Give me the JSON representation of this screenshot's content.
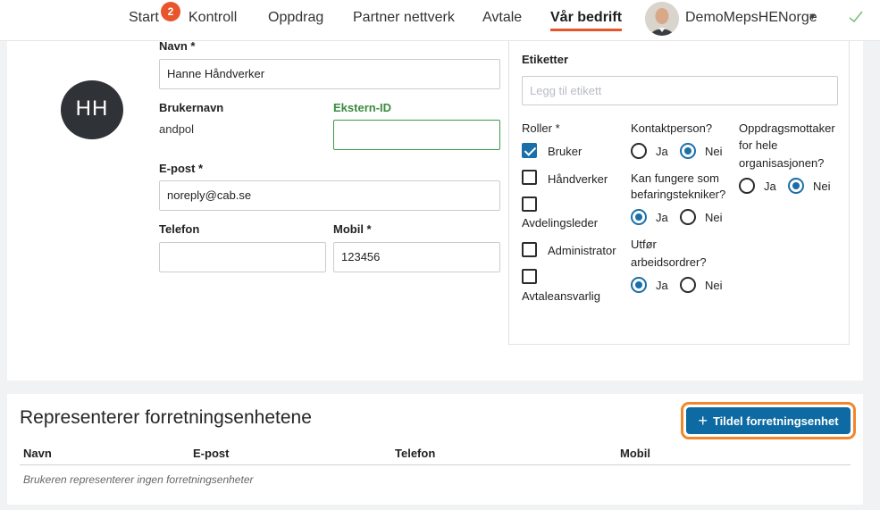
{
  "nav": {
    "items": [
      "Start",
      "Kontroll",
      "Oppdrag",
      "Partner nettverk",
      "Avtale",
      "Vår bedrift"
    ],
    "badge_count": "2",
    "account_name": "DemoMepsHENorge"
  },
  "user": {
    "initials": "HH",
    "name_label": "Navn *",
    "name_value": "Hanne Håndverker",
    "username_label": "Brukernavn",
    "username_value": "andpol",
    "external_id_label": "Ekstern-ID",
    "external_id_value": "",
    "email_label": "E-post *",
    "email_value": "noreply@cab.se",
    "phone_label": "Telefon",
    "phone_value": "",
    "mobile_label": "Mobil *",
    "mobile_value": "123456"
  },
  "tags": {
    "label": "Etiketter",
    "placeholder": "Legg til etikett"
  },
  "roles": {
    "label": "Roller *",
    "items": [
      {
        "label": "Bruker",
        "checked": true
      },
      {
        "label": "Håndverker",
        "checked": false
      },
      {
        "label": "Avdelingsleder",
        "checked": false
      },
      {
        "label": "Administrator",
        "checked": false
      },
      {
        "label": "Avtaleansvarlig",
        "checked": false
      }
    ]
  },
  "contact_person": {
    "label": "Kontaktperson?",
    "yes": "Ja",
    "no": "Nei",
    "selected": "Nei"
  },
  "inspection_tech": {
    "label_line1": "Kan fungere som",
    "label_line2": "befaringstekniker?",
    "yes": "Ja",
    "no": "Nei",
    "selected": "Ja"
  },
  "work_orders": {
    "label_line1": "Utfør",
    "label_line2": "arbeidsordrer?",
    "yes": "Ja",
    "no": "Nei",
    "selected": "Ja"
  },
  "org_receiver": {
    "label_line1": "Oppdragsmottaker",
    "label_line2": "for hele",
    "label_line3": "organisasjonen?",
    "yes": "Ja",
    "no": "Nei",
    "selected": "Nei"
  },
  "business_units": {
    "title": "Representerer forretningsenhetene",
    "assign_button": "Tildel forretningsenhet",
    "columns": [
      "Navn",
      "E-post",
      "Telefon",
      "Mobil"
    ],
    "empty_text": "Brukeren representerer ingen forretningsenheter"
  },
  "colors": {
    "accent_blue": "#0d6aa3",
    "nav_underline": "#e8552b",
    "highlight_outline": "#f0882a",
    "external_id_green": "#3b8a3e"
  }
}
